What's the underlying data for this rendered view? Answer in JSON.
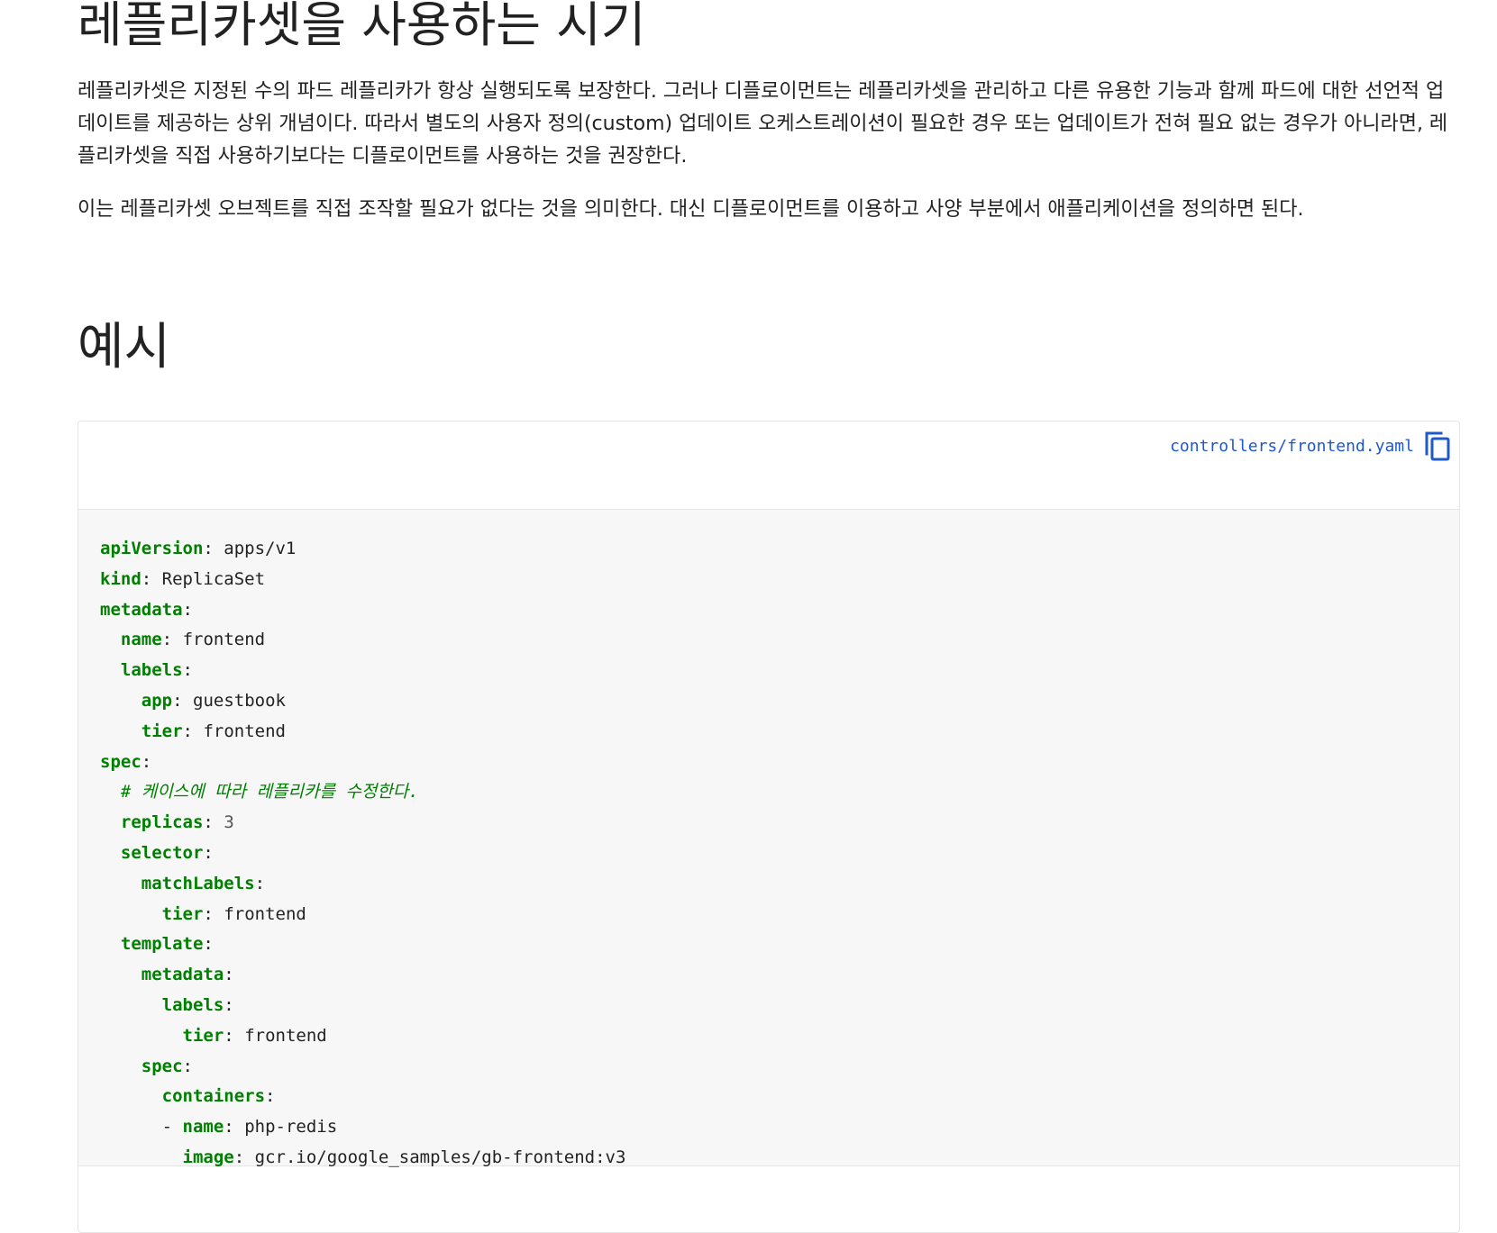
{
  "section_when": {
    "title": "레플리카셋을 사용하는 시기",
    "paragraph1": "레플리카셋은 지정된 수의 파드 레플리카가 항상 실행되도록 보장한다. 그러나 디플로이먼트는 레플리카셋을 관리하고 다른 유용한 기능과 함께 파드에 대한 선언적 업데이트를 제공하는 상위 개념이다. 따라서 별도의 사용자 정의(custom) 업데이트 오케스트레이션이 필요한 경우 또는 업데이트가 전혀 필요 없는 경우가 아니라면, 레플리카셋을 직접 사용하기보다는 디플로이먼트를 사용하는 것을 권장한다.",
    "paragraph2": "이는 레플리카셋 오브젝트를 직접 조작할 필요가 없다는 것을 의미한다. 대신 디플로이먼트를 이용하고 사양 부분에서 애플리케이션을 정의하면 된다."
  },
  "section_example": {
    "title": "예시"
  },
  "code_block": {
    "filename": "controllers/frontend.yaml",
    "copy_icon": "copy-icon",
    "lines": [
      {
        "indent": 0,
        "prefix": "",
        "key": "apiVersion",
        "value": "apps/v1"
      },
      {
        "indent": 0,
        "prefix": "",
        "key": "kind",
        "value": "ReplicaSet"
      },
      {
        "indent": 0,
        "prefix": "",
        "key": "metadata",
        "value": ""
      },
      {
        "indent": 1,
        "prefix": "",
        "key": "name",
        "value": "frontend"
      },
      {
        "indent": 1,
        "prefix": "",
        "key": "labels",
        "value": ""
      },
      {
        "indent": 2,
        "prefix": "",
        "key": "app",
        "value": "guestbook"
      },
      {
        "indent": 2,
        "prefix": "",
        "key": "tier",
        "value": "frontend"
      },
      {
        "indent": 0,
        "prefix": "",
        "key": "spec",
        "value": ""
      },
      {
        "indent": 1,
        "comment": "# 케이스에 따라 레플리카를 수정한다."
      },
      {
        "indent": 1,
        "prefix": "",
        "key": "replicas",
        "value": "3",
        "numeric": true
      },
      {
        "indent": 1,
        "prefix": "",
        "key": "selector",
        "value": ""
      },
      {
        "indent": 2,
        "prefix": "",
        "key": "matchLabels",
        "value": ""
      },
      {
        "indent": 3,
        "prefix": "",
        "key": "tier",
        "value": "frontend"
      },
      {
        "indent": 1,
        "prefix": "",
        "key": "template",
        "value": ""
      },
      {
        "indent": 2,
        "prefix": "",
        "key": "metadata",
        "value": ""
      },
      {
        "indent": 3,
        "prefix": "",
        "key": "labels",
        "value": ""
      },
      {
        "indent": 4,
        "prefix": "",
        "key": "tier",
        "value": "frontend"
      },
      {
        "indent": 2,
        "prefix": "",
        "key": "spec",
        "value": ""
      },
      {
        "indent": 3,
        "prefix": "",
        "key": "containers",
        "value": ""
      },
      {
        "indent": 3,
        "prefix": "- ",
        "key": "name",
        "value": "php-redis"
      },
      {
        "indent": 4,
        "prefix": "",
        "key": "image",
        "value": "gcr.io/google_samples/gb-frontend:v3"
      }
    ]
  },
  "colors": {
    "yaml_key": "#008000",
    "link": "#1f59c9",
    "code_background": "#f7f7f7"
  }
}
